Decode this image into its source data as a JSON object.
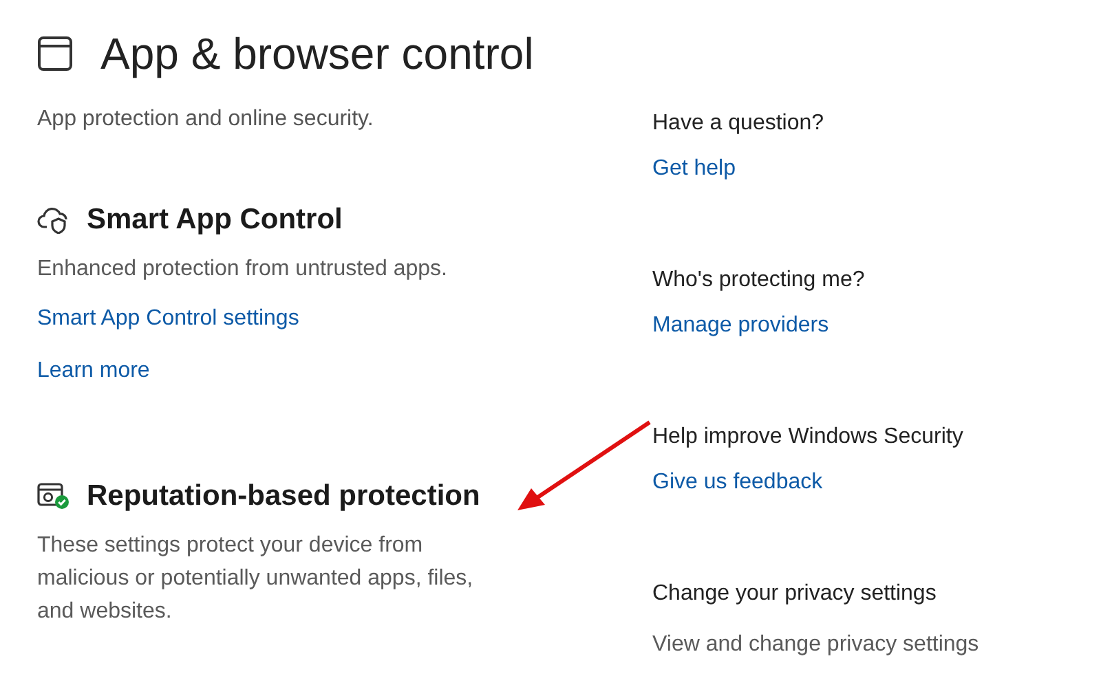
{
  "page": {
    "title": "App & browser control",
    "subtitle": "App protection and online security."
  },
  "sections": [
    {
      "kind": "cloud-shield",
      "heading": "Smart App Control",
      "description": "Enhanced protection from untrusted apps.",
      "links": [
        "Smart App Control settings",
        "Learn more"
      ]
    },
    {
      "kind": "reputation",
      "heading": "Reputation-based protection",
      "description": "These settings protect your device from malicious or potentially unwanted apps, files, and websites."
    }
  ],
  "sidebar": [
    {
      "heading": "Have a question?",
      "link": "Get help"
    },
    {
      "heading": "Who's protecting me?",
      "link": "Manage providers"
    },
    {
      "heading": "Help improve Windows Security",
      "link": "Give us feedback"
    },
    {
      "heading": "Change your privacy settings",
      "text": "View and change privacy settings"
    }
  ]
}
